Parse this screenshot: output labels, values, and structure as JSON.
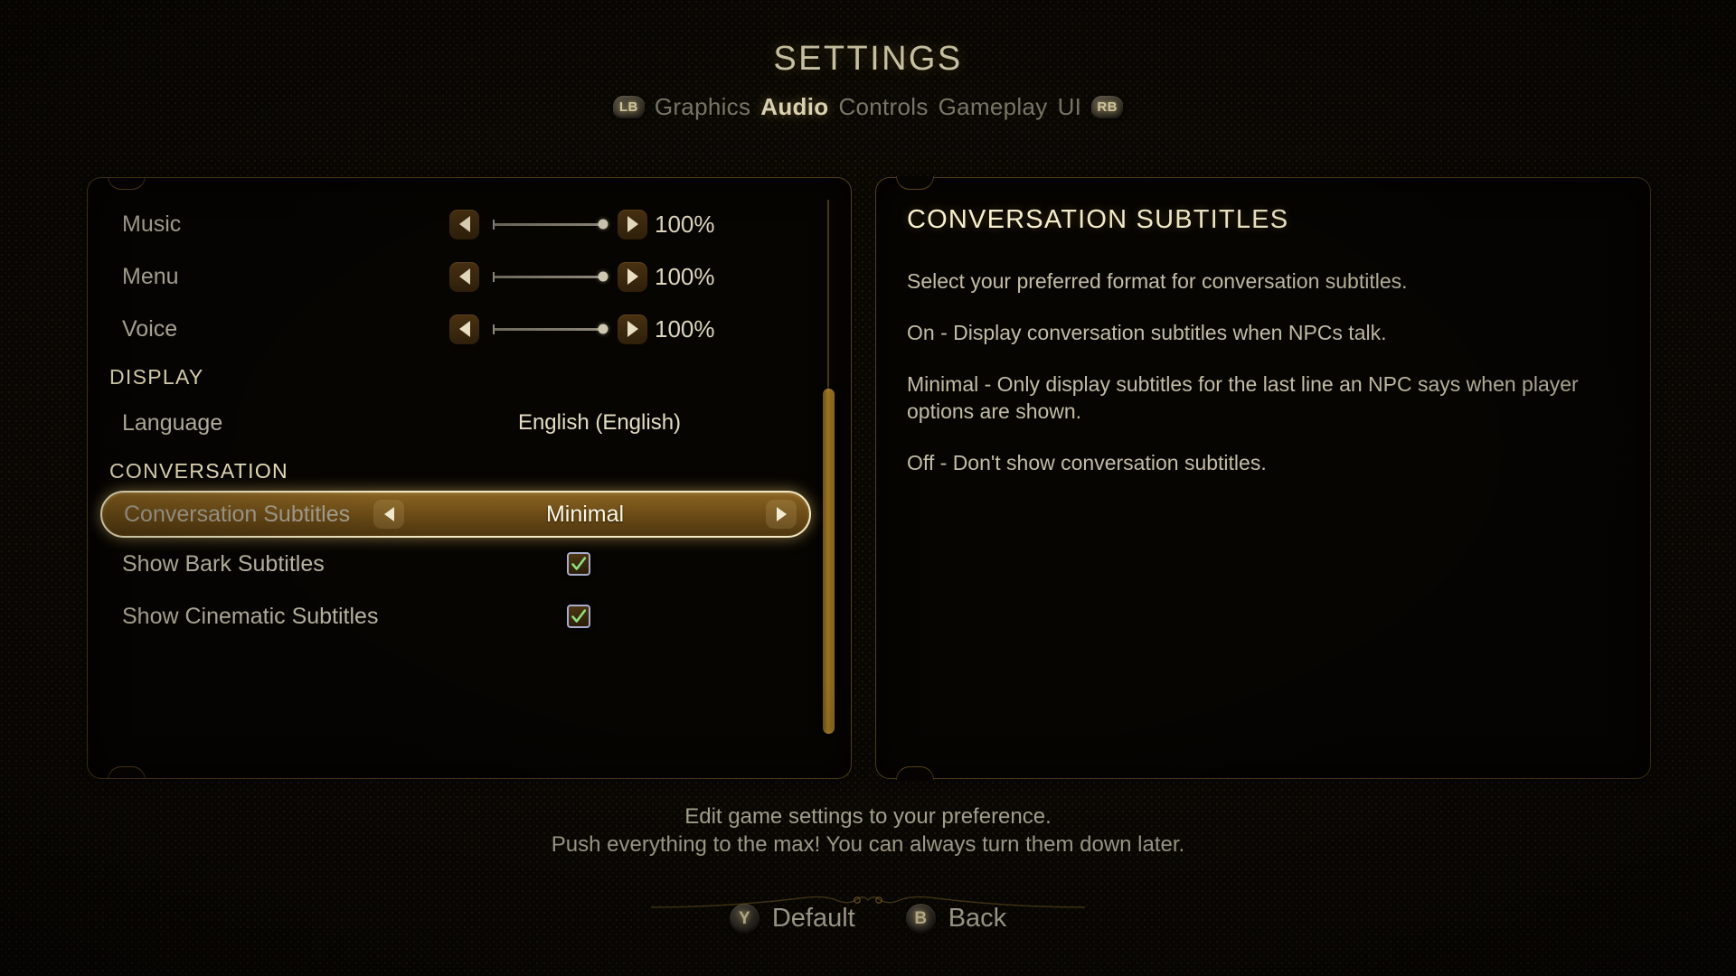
{
  "header": {
    "title": "SETTINGS",
    "bumper_left": "LB",
    "bumper_right": "RB",
    "tabs": [
      {
        "label": "Graphics",
        "active": false
      },
      {
        "label": "Audio",
        "active": true
      },
      {
        "label": "Controls",
        "active": false
      },
      {
        "label": "Gameplay",
        "active": false
      },
      {
        "label": "UI",
        "active": false
      }
    ]
  },
  "settings_list": {
    "rows": [
      {
        "type": "slider",
        "label": "Music",
        "value": "100%",
        "percent": 100
      },
      {
        "type": "slider",
        "label": "Menu",
        "value": "100%",
        "percent": 100
      },
      {
        "type": "slider",
        "label": "Voice",
        "value": "100%",
        "percent": 100
      },
      {
        "type": "section",
        "label": "DISPLAY"
      },
      {
        "type": "value",
        "label": "Language",
        "value": "English (English)"
      },
      {
        "type": "section",
        "label": "CONVERSATION"
      },
      {
        "type": "selector",
        "label": "Conversation Subtitles",
        "value": "Minimal",
        "selected": true
      },
      {
        "type": "checkbox",
        "label": "Show Bark Subtitles",
        "checked": true
      },
      {
        "type": "checkbox",
        "label": "Show Cinematic Subtitles",
        "checked": true
      }
    ],
    "scroll_position_percent": 34
  },
  "description": {
    "title": "CONVERSATION SUBTITLES",
    "paragraphs": [
      "Select your preferred format for conversation subtitles.",
      "On - Display conversation subtitles when NPCs talk.",
      "Minimal - Only display subtitles for the last line an NPC says when player options are shown.",
      "Off - Don't show conversation subtitles."
    ]
  },
  "hints": {
    "line1": "Edit game settings to your preference.",
    "line2": "Push everything to the max! You can always turn them down later."
  },
  "footer": {
    "buttons": [
      {
        "glyph": "Y",
        "label": "Default"
      },
      {
        "glyph": "B",
        "label": "Back"
      }
    ]
  },
  "colors": {
    "accent_gold": "#9a7424",
    "cream": "#fbf2ce",
    "muted_text": "#c3bda5",
    "check_green": "#8ee07a",
    "panel_bg": "#070502"
  }
}
